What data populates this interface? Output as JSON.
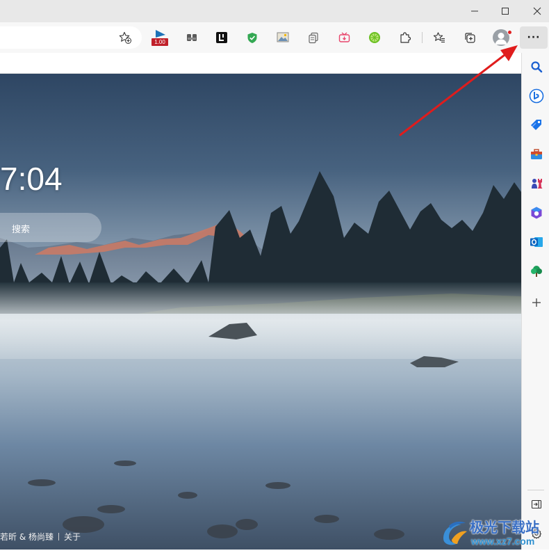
{
  "window": {
    "controls": [
      {
        "name": "minimize",
        "icon": "minimize-icon"
      },
      {
        "name": "maximize",
        "icon": "maximize-icon"
      },
      {
        "name": "close",
        "icon": "close-icon"
      }
    ]
  },
  "toolbar": {
    "favorite_icon": "star-add-icon",
    "extensions": [
      {
        "name": "speed-extension",
        "badge": "1.00",
        "color": "#1e73b8"
      },
      {
        "name": "tab-group-extension",
        "color": "#555555"
      },
      {
        "name": "l-extension",
        "color": "#111111"
      },
      {
        "name": "shield-extension",
        "color": "#34a853"
      },
      {
        "name": "image-extension",
        "color": "#6a8fb5"
      },
      {
        "name": "copy-extension",
        "color": "#666666"
      },
      {
        "name": "tv-extension",
        "color": "#e8456b"
      },
      {
        "name": "lime-extension",
        "color": "#6cc024"
      }
    ],
    "puzzle_icon": "puzzle-icon",
    "favorites_icon": "favorites-icon",
    "collections_icon": "collections-icon",
    "profile_icon": "profile-icon",
    "menu_label": "···"
  },
  "newtab": {
    "clock": "7:04",
    "search_placeholder": "搜索",
    "credit_author": "若昕 & 杨尚臻",
    "credit_about": "关于"
  },
  "sidebar": {
    "items": [
      {
        "name": "search",
        "icon": "search-icon",
        "color": "#1a5fd0"
      },
      {
        "name": "bing",
        "icon": "bing-icon",
        "color": "#1a6fe0"
      },
      {
        "name": "shopping",
        "icon": "tag-icon",
        "color": "#1a73e8"
      },
      {
        "name": "tools",
        "icon": "toolbox-icon",
        "color": "#d04a2a"
      },
      {
        "name": "games",
        "icon": "chess-icon",
        "color": "#3a4ab5"
      },
      {
        "name": "office",
        "icon": "office-icon",
        "color": "#7b48d6"
      },
      {
        "name": "outlook",
        "icon": "outlook-icon",
        "color": "#0a64c0"
      },
      {
        "name": "drop",
        "icon": "tree-icon",
        "color": "#1e9e5a"
      },
      {
        "name": "add",
        "icon": "plus-icon",
        "color": "#444444"
      }
    ],
    "bottom": [
      {
        "name": "hide-sidebar",
        "icon": "sidebar-collapse-icon"
      },
      {
        "name": "settings",
        "icon": "gear-icon"
      }
    ]
  },
  "watermark": {
    "title": "极光下载站",
    "url": "www.xz7.com"
  },
  "colors": {
    "accent": "#e01c1c",
    "titlebar": "#e8e8e8",
    "toolbar": "#f7f7f7"
  }
}
